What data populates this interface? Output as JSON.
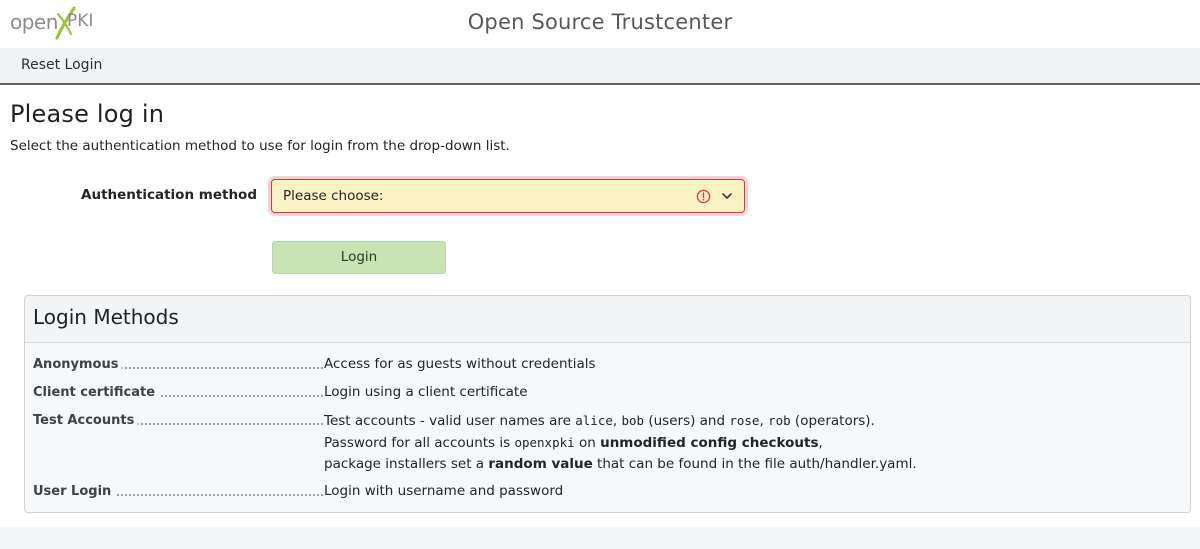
{
  "header": {
    "logo_open": "open",
    "logo_pki": "PKI",
    "site_title": "Open Source Trustcenter"
  },
  "nav": {
    "reset_login": "Reset Login"
  },
  "main": {
    "title": "Please log in",
    "description": "Select the authentication method to use for login from the drop-down list.",
    "auth_label": "Authentication method",
    "auth_select_value": "Please choose:",
    "login_button": "Login"
  },
  "methods": {
    "title": "Login Methods",
    "items": [
      {
        "term": "Anonymous",
        "desc": "Access for as guests without credentials"
      },
      {
        "term": "Client certificate",
        "desc": "Login using a client certificate"
      },
      {
        "term": "Test Accounts",
        "desc_line1_a": "Test accounts - valid user names are ",
        "code_alice": "alice",
        "sep1": ", ",
        "code_bob": "bob",
        "desc_line1_b": " (users) and ",
        "code_rose": "rose",
        "sep2": ", ",
        "code_rob": "rob",
        "desc_line1_c": " (operators).",
        "desc_line2_a": "Password for all accounts is ",
        "code_password": "openxpki",
        "desc_line2_b": " on ",
        "desc_line2_bold": "unmodified config checkouts",
        "desc_line2_c": ",",
        "desc_line3_a": "package installers set a ",
        "desc_line3_bold": "random value",
        "desc_line3_b": " that can be found in the file auth/handler.yaml."
      },
      {
        "term": "User Login",
        "desc": "Login with username and password"
      }
    ]
  },
  "colors": {
    "select_bg": "#fcf3c4",
    "select_border_error": "#dc3545",
    "login_button_bg": "#c8e3b4",
    "logo_accent": "#9bc53d"
  },
  "icons": {
    "select_error": "exclamation-circle-icon",
    "select_toggle": "chevron-down-icon",
    "logo_mark": "x-swoosh-icon"
  }
}
